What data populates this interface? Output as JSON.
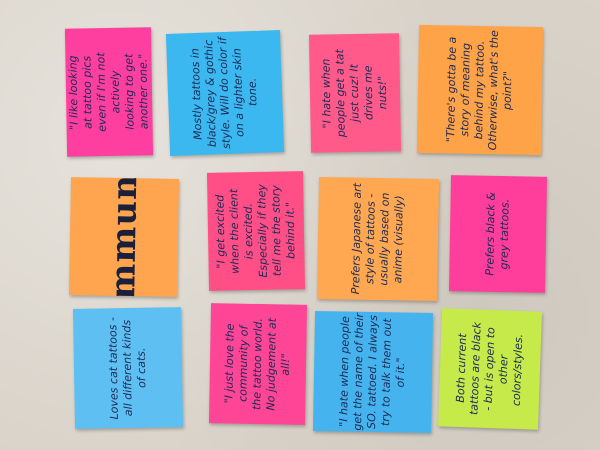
{
  "notes": {
    "n1": {
      "text": "\"I like looking at tattoo pics even if I'm not actively looking to get another one.\"",
      "color": "#ff3fa0"
    },
    "n2": {
      "text": "Mostly tattoos in black/grey & gothic style. Will do color if on a lighter skin tone.",
      "color": "#3bb8f0"
    },
    "n3": {
      "text": "\"I hate when people get a tat just cuz! It drives me nuts!\"",
      "color": "#ff5a8a"
    },
    "n4": {
      "text": "\"There's gotta be a story of meaning behind my tattoo. Otherwise, what's the point?\"",
      "color": "#ffa348"
    },
    "n5": {
      "text": "Community",
      "color": "#ffa550"
    },
    "n6": {
      "text": "\"I get excited when the client is excited. Especially if they tell me the story behind it.\"",
      "color": "#ff4f86"
    },
    "n7": {
      "text": "Prefers Japanese art style of tattoos - usually based on anime (visually)",
      "color": "#ffa851"
    },
    "n8": {
      "text": "Prefers black & grey tattoos.",
      "color": "#ff3d9a"
    },
    "n9": {
      "text": "Loves cat tattoos - all different kinds of cats.",
      "color": "#5ec0f2"
    },
    "n10": {
      "text": "\"I just love the community of the tattoo world. No judgement at all!\"",
      "color": "#ff4596"
    },
    "n11": {
      "text": "\"I hate when people get the name of their SO. tattoed. I always try to talk them out of it.\"",
      "color": "#45b4ee"
    },
    "n12": {
      "text": "Both current tattoos are black - but is open to other colors/styles.",
      "color": "#c5ea4a"
    }
  }
}
